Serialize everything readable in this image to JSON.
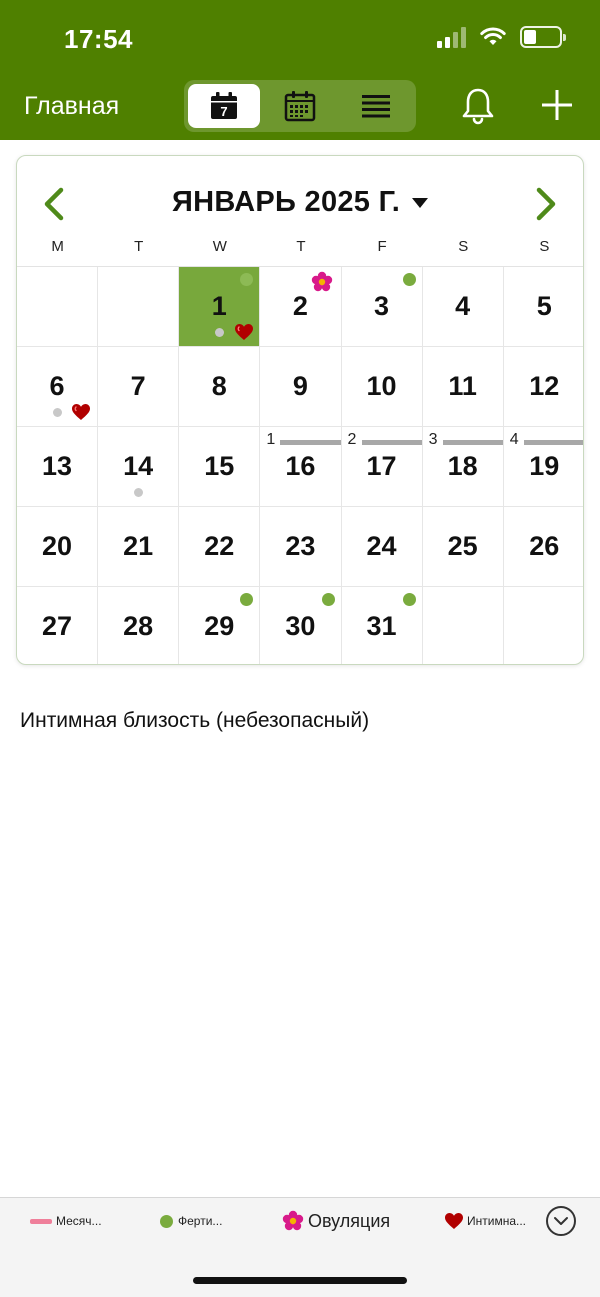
{
  "status": {
    "time": "17:54"
  },
  "header": {
    "title": "Главная",
    "view_day_number": "7"
  },
  "calendar": {
    "month_label": "ЯНВАРЬ 2025 Г.",
    "weekdays": [
      "M",
      "T",
      "W",
      "T",
      "F",
      "S",
      "S"
    ],
    "cells": [
      {
        "day": ""
      },
      {
        "day": ""
      },
      {
        "day": "1",
        "today": true,
        "dot_green": true,
        "dot_grey": true,
        "heart": true
      },
      {
        "day": "2",
        "flower": true
      },
      {
        "day": "3",
        "dot_green": true
      },
      {
        "day": "4"
      },
      {
        "day": "5"
      },
      {
        "day": "6",
        "dot_grey": true,
        "heart": true
      },
      {
        "day": "7"
      },
      {
        "day": "8"
      },
      {
        "day": "9"
      },
      {
        "day": "10"
      },
      {
        "day": "11"
      },
      {
        "day": "12"
      },
      {
        "day": "13"
      },
      {
        "day": "14",
        "dot_grey": true
      },
      {
        "day": "15"
      },
      {
        "day": "16",
        "cycle": "1"
      },
      {
        "day": "17",
        "cycle": "2"
      },
      {
        "day": "18",
        "cycle": "3"
      },
      {
        "day": "19",
        "cycle": "4"
      },
      {
        "day": "20"
      },
      {
        "day": "21"
      },
      {
        "day": "22"
      },
      {
        "day": "23"
      },
      {
        "day": "24"
      },
      {
        "day": "25"
      },
      {
        "day": "26"
      },
      {
        "day": "27"
      },
      {
        "day": "28"
      },
      {
        "day": "29",
        "dot_green": true
      },
      {
        "day": "30",
        "dot_green": true
      },
      {
        "day": "31",
        "dot_green": true
      },
      {
        "day": ""
      },
      {
        "day": ""
      }
    ]
  },
  "note": "Интимная близость (небезопасный)",
  "legend": {
    "period": "Месяч...",
    "fertile": "Ферти...",
    "ovulation": "Овуляция",
    "intimacy": "Интимна..."
  },
  "colors": {
    "header_green": "#4f8000",
    "today_green": "#78a83c",
    "fertile_dot": "#7aab3e",
    "period_pink": "#ef7f9a",
    "heart_red": "#b10000",
    "flower_magenta": "#d81a8a"
  },
  "icons": {
    "view_day": "calendar-day-icon",
    "view_month": "calendar-month-icon",
    "view_list": "list-icon",
    "notifications": "bell-icon",
    "add": "plus-icon",
    "prev": "chevron-left-icon",
    "next": "chevron-right-icon",
    "expand": "chevron-down-circle-icon"
  }
}
